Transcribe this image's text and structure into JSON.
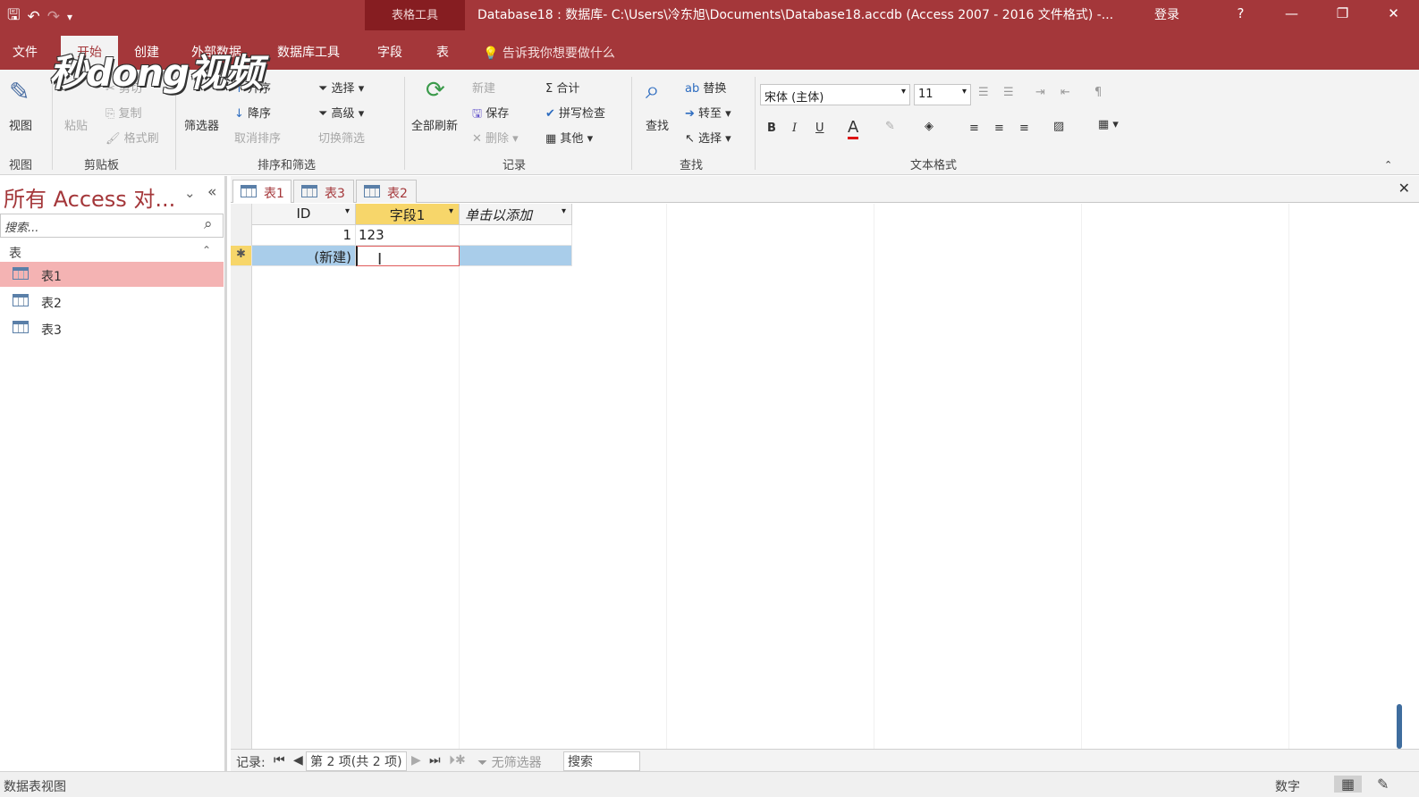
{
  "title_bar": {
    "context_tab_group": "表格工具",
    "window_title": "Database18 : 数据库- C:\\Users\\冷东旭\\Documents\\Database18.accdb (Access 2007 - 2016 文件格式) -...",
    "sign_in": "登录",
    "help": "?",
    "minimize": "—",
    "restore": "❐",
    "close": "✕"
  },
  "ribbon_tabs": [
    "文件",
    "开始",
    "创建",
    "外部数据",
    "数据库工具",
    "字段",
    "表"
  ],
  "tell_me": "告诉我你想要做什么",
  "watermark": "秒dong视频",
  "ribbon": {
    "view": {
      "label": "视图",
      "group": "视图"
    },
    "clipboard": {
      "paste": "粘贴",
      "cut": "剪切",
      "copy": "复制",
      "format_painter": "格式刷",
      "group": "剪贴板"
    },
    "sort_filter": {
      "filter": "筛选器",
      "ascending": "升序",
      "descending": "降序",
      "remove_sort": "取消排序",
      "selection": "选择",
      "advanced": "高级",
      "toggle_filter": "切换筛选",
      "group": "排序和筛选"
    },
    "records": {
      "refresh_all": "全部刷新",
      "new": "新建",
      "save": "保存",
      "delete": "删除",
      "totals": "合计",
      "spelling": "拼写检查",
      "more": "其他",
      "group": "记录"
    },
    "find": {
      "find": "查找",
      "replace": "替换",
      "goto": "转至",
      "select": "选择",
      "group": "查找"
    },
    "text_format": {
      "font": "宋体 (主体)",
      "size": "11",
      "bold": "B",
      "italic": "I",
      "underline": "U",
      "group": "文本格式"
    }
  },
  "nav_pane": {
    "title": "所有 Access 对...",
    "search_placeholder": "搜索...",
    "group": "表",
    "items": [
      "表1",
      "表2",
      "表3"
    ]
  },
  "doc_tabs": [
    "表1",
    "表3",
    "表2"
  ],
  "datasheet": {
    "columns": [
      "ID",
      "字段1",
      "单击以添加"
    ],
    "rows": [
      {
        "id": "1",
        "field1": "123"
      },
      {
        "id": "(新建)",
        "field1": "",
        "marker": "✱"
      }
    ]
  },
  "record_nav": {
    "label": "记录:",
    "position": "第 2 项(共 2 项)",
    "no_filter": "无筛选器",
    "search": "搜索"
  },
  "status_bar": {
    "left": "数据表视图",
    "mode": "数字"
  }
}
